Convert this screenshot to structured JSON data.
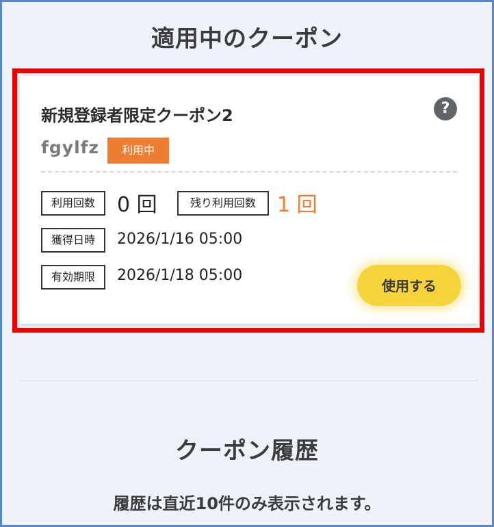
{
  "active_section": {
    "title": "適用中のクーポン"
  },
  "coupon": {
    "name": "新規登録者限定クーポン2",
    "help_icon": "?",
    "code": "fgylfz",
    "status": "利用中",
    "usage_count_label": "利用回数",
    "usage_count_value": "0 回",
    "remaining_label": "残り利用回数",
    "remaining_value": "1 回",
    "acquired_label": "獲得日時",
    "acquired_value": "2026/1/16 05:00",
    "expiry_label": "有効期限",
    "expiry_value": "2026/1/18 05:00",
    "use_button_label": "使用する"
  },
  "history_section": {
    "title": "クーポン履歴",
    "note": "履歴は直近10件のみ表示されます。"
  },
  "colors": {
    "status_badge": "#ef7d31",
    "use_button": "#f5d33a",
    "highlight_border": "#ee0000",
    "frame_border": "#5a86c6"
  }
}
